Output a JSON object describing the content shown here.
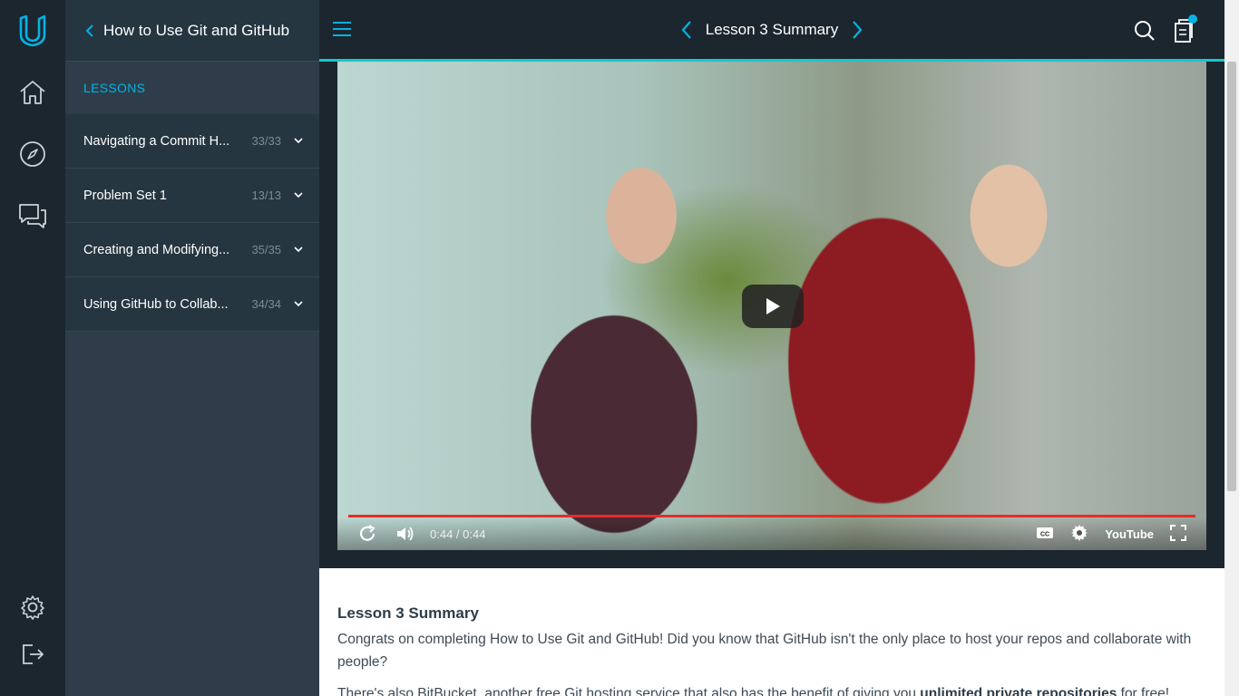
{
  "rail": {
    "logo": "udacity-logo-icon",
    "items": [
      "home-icon",
      "compass-icon",
      "chat-icon"
    ],
    "bottom": [
      "gear-icon",
      "logout-icon"
    ]
  },
  "sidebar": {
    "course_title": "How to Use Git and GitHub",
    "section_label": "LESSONS",
    "lessons": [
      {
        "title": "Navigating a Commit H...",
        "count": "33/33"
      },
      {
        "title": "Problem Set 1",
        "count": "13/13"
      },
      {
        "title": "Creating and Modifying...",
        "count": "35/35"
      },
      {
        "title": "Using GitHub to Collab...",
        "count": "34/34"
      }
    ]
  },
  "topbar": {
    "title": "Lesson 3 Summary"
  },
  "video": {
    "time": "0:44 / 0:44",
    "progress": 1.0,
    "brand": "YouTube"
  },
  "content": {
    "heading": "Lesson 3 Summary",
    "para1": "Congrats on completing How to Use Git and GitHub! Did you know that GitHub isn't the only place to host your repos and collaborate with people?",
    "para2_start": "There's also BitBucket, another free Git hosting service that also has the benefit of giving you ",
    "para2_bold": "unlimited private repositories",
    "para2_end": " for free!"
  },
  "colors": {
    "accent": "#02b3e4",
    "topbar_border": "#15c8cf",
    "rail_bg": "#1c262f",
    "sidebar_bg": "#2e3d49",
    "progress": "#e52d27"
  }
}
